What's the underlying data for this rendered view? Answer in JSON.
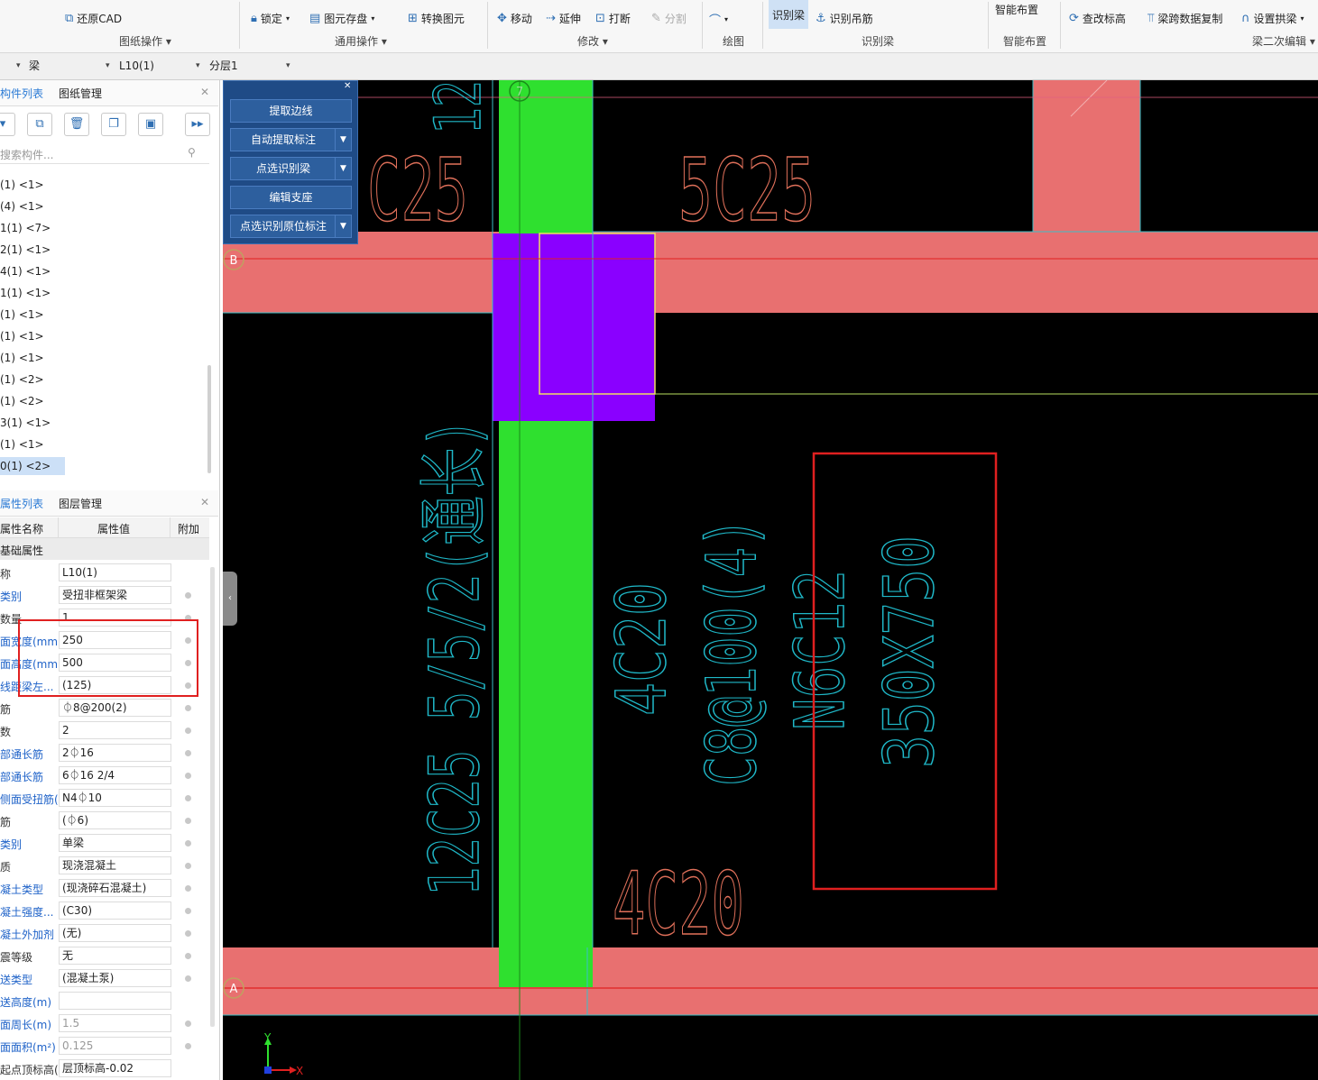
{
  "ribbon": {
    "restore_cad": "还原CAD",
    "lock": "锁定",
    "element_save": "图元存盘",
    "convert_element": "转换图元",
    "move": "移动",
    "extend": "延伸",
    "break": "打断",
    "split": "分割",
    "identify_beam": "识别梁",
    "identify_hanger": "识别吊筋",
    "smart_layout": "智能布置",
    "check_elevation": "查改标高",
    "beam_span_copy": "梁跨数据复制",
    "set_arch": "设置拱梁",
    "groups": {
      "drawing_ops": "图纸操作",
      "general_ops": "通用操作",
      "modify": "修改",
      "draw": "绘图",
      "identify_beam": "识别梁",
      "smart_layout": "智能布置",
      "beam_secondary_edit": "梁二次编辑"
    }
  },
  "selectors": {
    "type": "梁",
    "component": "L10(1)",
    "layer": "分层1"
  },
  "component_panel": {
    "tab_list": "构件列表",
    "tab_drawing": "图纸管理",
    "search_placeholder": "搜索构件...",
    "items": [
      "(1) <1>",
      "(4) <1>",
      "1(1) <7>",
      "2(1) <1>",
      "4(1) <1>",
      "1(1) <1>",
      "(1) <1>",
      "(1) <1>",
      "(1) <1>",
      "(1) <2>",
      "(1) <2>",
      "3(1) <1>",
      "(1) <1>",
      "0(1) <2>"
    ]
  },
  "property_panel": {
    "tab_props": "属性列表",
    "tab_layers": "图层管理",
    "col_name": "属性名称",
    "col_value": "属性值",
    "col_extra": "附加",
    "section": "基础属性",
    "rows": [
      {
        "name": "称",
        "value": "L10(1)"
      },
      {
        "name": "类别",
        "value": "受扭非框架梁"
      },
      {
        "name": "数量",
        "value": "1"
      },
      {
        "name": "面宽度(mm)",
        "value": "250"
      },
      {
        "name": "面高度(mm)",
        "value": "500"
      },
      {
        "name": "线距梁左...",
        "value": "(125)"
      },
      {
        "name": "筋",
        "value": "⏀8@200(2)"
      },
      {
        "name": "数",
        "value": "2"
      },
      {
        "name": "部通长筋",
        "value": "2⏀16"
      },
      {
        "name": "部通长筋",
        "value": "6⏀16 2/4"
      },
      {
        "name": "侧面受扭筋(...",
        "value": "N4⏀10"
      },
      {
        "name": "筋",
        "value": "(⏀6)"
      },
      {
        "name": "类别",
        "value": "单梁"
      },
      {
        "name": "质",
        "value": "现浇混凝土"
      },
      {
        "name": "凝土类型",
        "value": "(现浇碎石混凝土)"
      },
      {
        "name": "凝土强度...",
        "value": "(C30)"
      },
      {
        "name": "凝土外加剂",
        "value": "(无)"
      },
      {
        "name": "震等级",
        "value": "无"
      },
      {
        "name": "送类型",
        "value": "(混凝土泵)"
      },
      {
        "name": "送高度(m)",
        "value": ""
      },
      {
        "name": "面周长(m)",
        "value": "1.5"
      },
      {
        "name": "面面积(m²)",
        "value": "0.125"
      },
      {
        "name": "起点顶标高(m)",
        "value": "层顶标高-0.02"
      }
    ]
  },
  "float_panel": {
    "extract_edge": "提取边线",
    "auto_extract_label": "自动提取标注",
    "pick_identify_beam": "点选识别梁",
    "edit_support": "编辑支座",
    "pick_identify_inplace": "点选识别原位标注"
  },
  "cad": {
    "axis_7": "7",
    "axis_b": "B",
    "axis_a": "A",
    "text_c25_top": "C25",
    "text_12_top": "12",
    "text_5c25": "5C25",
    "text_left_vertical": "12C25 5/5/2(通长)",
    "text_4c20_vert": "4C20",
    "text_stirrup": "C8@100(4)",
    "text_n6c12": "N6C12",
    "text_section": "350X750",
    "text_4c20_bottom": "4C20",
    "ucs_y": "Y",
    "ucs_x": "X",
    "colors": {
      "background": "#000000",
      "beam": "#e87070",
      "column": "#2fe02f",
      "selection": "#8a00ff",
      "annotation_cyan": "#1fb8c8",
      "annotation_orange": "#e0705a",
      "highlight_red": "#e02020"
    }
  }
}
